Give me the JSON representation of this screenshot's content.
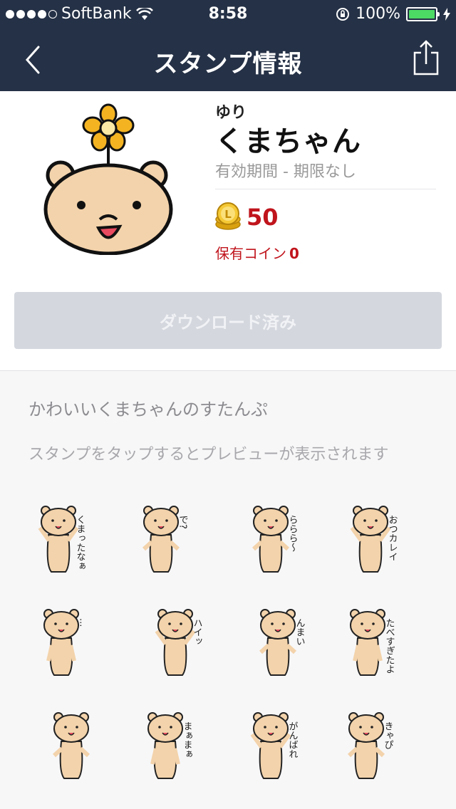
{
  "status_bar": {
    "carrier": "SoftBank",
    "time": "8:58",
    "battery": "100%"
  },
  "nav": {
    "title": "スタンプ情報"
  },
  "sticker_pack": {
    "author": "ゆり",
    "name": "くまちゃん",
    "validity": "有効期間 - 期限なし",
    "price": "50",
    "owned_label": "保有コイン",
    "owned_value": "0",
    "download_button": "ダウンロード済み"
  },
  "description": "かわいいくまちゃんのすたんぷ",
  "preview_hint": "スタンプをタップするとプレビューが表示されます",
  "stickers": [
    {
      "label": "くまったなぁ"
    },
    {
      "label": "で?"
    },
    {
      "label": "ららら〜"
    },
    {
      "label": "おつカレイ"
    },
    {
      "label": "..."
    },
    {
      "label": "ハイッ"
    },
    {
      "label": "んまい"
    },
    {
      "label": "たべすぎたよ"
    },
    {
      "label": ""
    },
    {
      "label": "まぁまぁ"
    },
    {
      "label": "がんばれ"
    },
    {
      "label": "きゃぴ"
    }
  ],
  "colors": {
    "nav_bg": "#253146",
    "price": "#c0141c",
    "button_disabled": "#d4d7de",
    "bear": "#f3d3ab"
  }
}
